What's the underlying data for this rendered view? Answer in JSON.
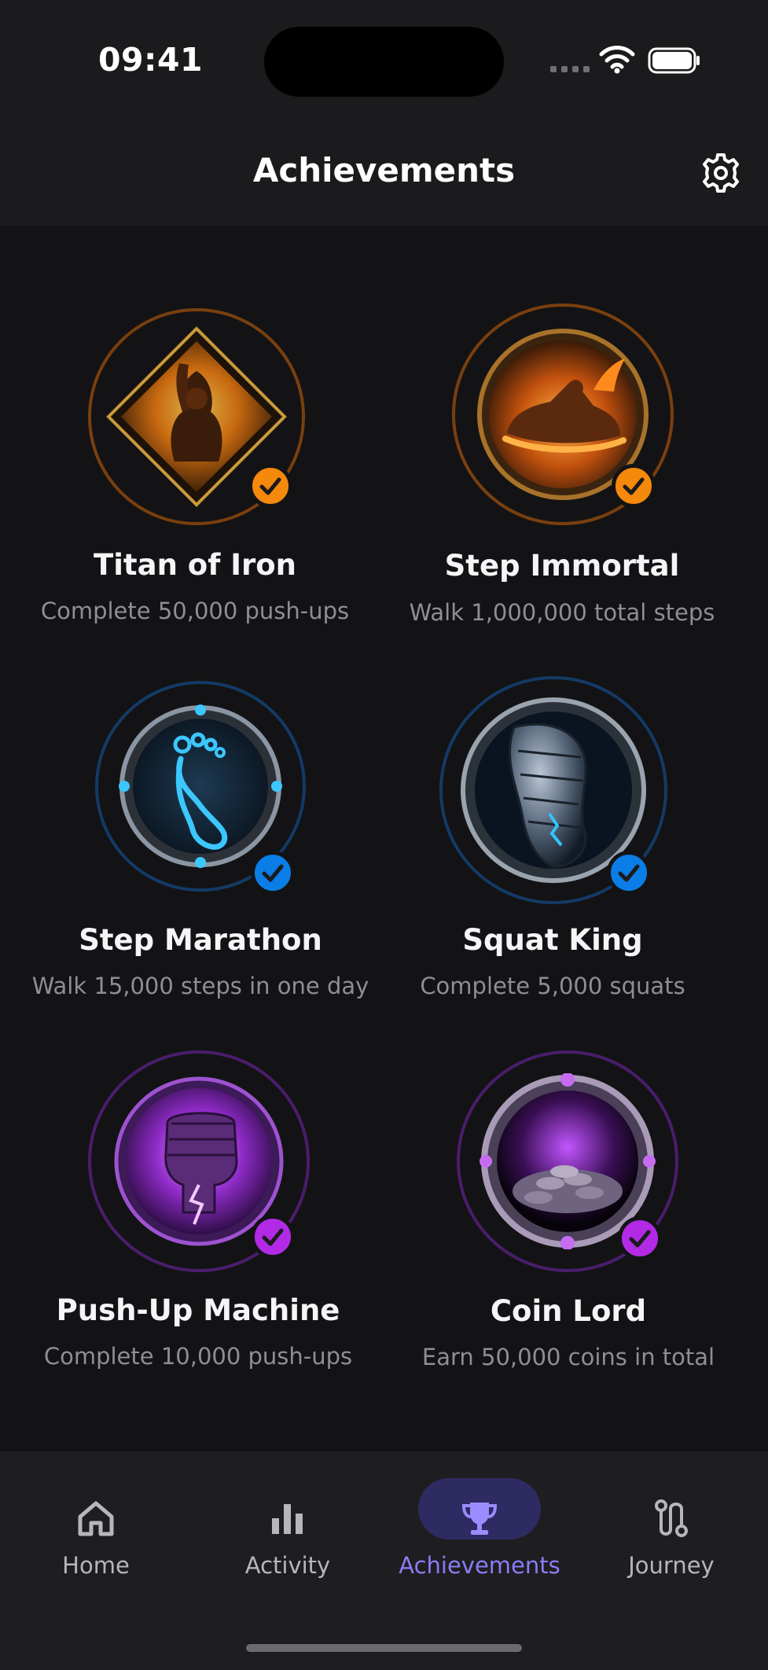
{
  "status_bar": {
    "time": "09:41"
  },
  "header": {
    "title": "Achievements",
    "settings_icon": "gear-icon"
  },
  "accents": {
    "orange": "#f5890b",
    "blue": "#0a7de6",
    "purple": "#b22ae6"
  },
  "achievements": [
    {
      "name": "Titan of Iron",
      "description": "Complete 50,000 push-ups",
      "tier": "orange",
      "icon": "flexing-titan-icon",
      "completed": true
    },
    {
      "name": "Step Immortal",
      "description": "Walk 1,000,000 total steps",
      "tier": "orange",
      "icon": "flaming-sneaker-icon",
      "completed": true
    },
    {
      "name": "Step Marathon",
      "description": "Walk 15,000 steps in one day",
      "tier": "blue",
      "icon": "footprint-icon",
      "completed": true
    },
    {
      "name": "Squat King",
      "description": "Complete 5,000 squats",
      "tier": "blue",
      "icon": "armored-leg-icon",
      "completed": true
    },
    {
      "name": "Push-Up Machine",
      "description": "Complete 10,000 push-ups",
      "tier": "purple",
      "icon": "lightning-fist-icon",
      "completed": true
    },
    {
      "name": "Coin Lord",
      "description": "Earn 50,000 coins in total",
      "tier": "purple",
      "icon": "coin-pile-icon",
      "completed": true
    }
  ],
  "nav": {
    "items": [
      {
        "label": "Home",
        "icon": "home-icon"
      },
      {
        "label": "Activity",
        "icon": "bar-chart-icon"
      },
      {
        "label": "Achievements",
        "icon": "trophy-icon",
        "active": true
      },
      {
        "label": "Journey",
        "icon": "route-icon"
      }
    ]
  }
}
